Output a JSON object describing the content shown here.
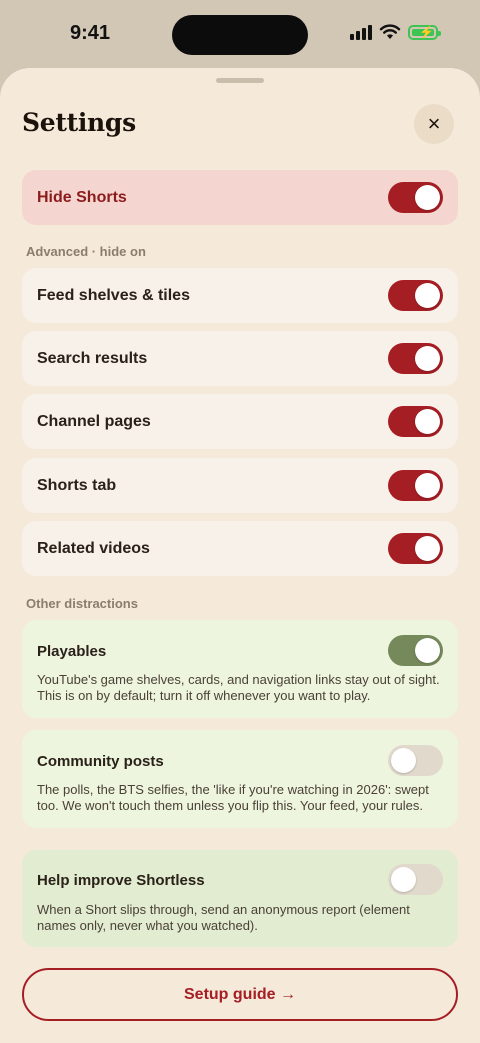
{
  "status_bar": {
    "time": "9:41"
  },
  "sheet": {
    "title": "Settings",
    "close_icon": "×"
  },
  "hide_shorts": {
    "label": "Hide Shorts",
    "on": true
  },
  "advanced": {
    "section_label": "Advanced · hide on",
    "items": [
      {
        "label": "Feed shelves & tiles",
        "on": true
      },
      {
        "label": "Search results",
        "on": true
      },
      {
        "label": "Channel pages",
        "on": true
      },
      {
        "label": "Shorts tab",
        "on": true
      },
      {
        "label": "Related videos",
        "on": true
      }
    ]
  },
  "other": {
    "section_label": "Other distractions",
    "playables": {
      "title": "Playables",
      "description": "YouTube's game shelves, cards, and navigation links stay out of sight. This is on by default; turn it off whenever you want to play.",
      "on": true
    },
    "community": {
      "title": "Community posts",
      "description": "The polls, the BTS selfies, the 'like if you're watching in 2026': swept too. We won't touch them unless you flip this. Your feed, your rules.",
      "on": false
    }
  },
  "help": {
    "title": "Help improve Shortless",
    "description": "When a Short slips through, send an anonymous report (element names only, never what you watched).",
    "on": false
  },
  "setup_guide": {
    "label": "Setup guide →"
  },
  "colors": {
    "accent": "#a51e24",
    "sheet_bg": "#f5e9d9",
    "green_toggle": "#76895a",
    "battery": "#3dc452"
  },
  "icons": [
    "signal-icon",
    "wifi-icon",
    "battery-charging-icon",
    "close-icon",
    "arrow-right-icon"
  ]
}
